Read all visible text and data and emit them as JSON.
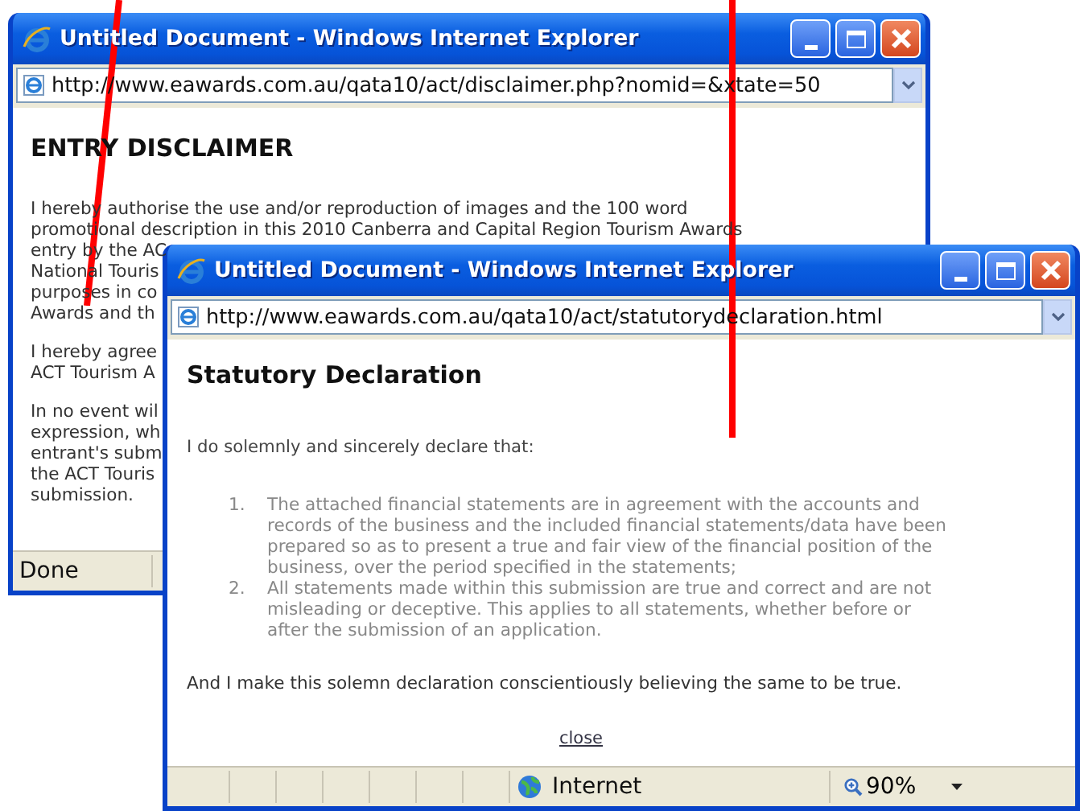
{
  "back_window": {
    "title": "Untitled Document - Windows Internet Explorer",
    "address": "http://www.eawards.com.au/qata10/act/disclaimer.php?nomid=&xtate=50",
    "heading": "ENTRY DISCLAIMER",
    "paragraphs": [
      [
        "I hereby authorise the use and/or reproduction of images and the 100 word",
        "promotional description in this 2010 Canberra and Capital Region Tourism Awards",
        "entry by the AC",
        "National Touris",
        "purposes in co",
        "Awards and th"
      ],
      [
        "I hereby agree",
        "ACT Tourism A"
      ],
      [
        "In no event wil",
        "expression, wh",
        "entrant's subm",
        "the ACT Touris",
        "submission."
      ]
    ],
    "status": "Done"
  },
  "front_window": {
    "title": "Untitled Document - Windows Internet Explorer",
    "address": "http://www.eawards.com.au/qata10/act/statutorydeclaration.html",
    "heading": "Statutory Declaration",
    "intro": "I do solemnly and sincerely declare that:",
    "items": [
      {
        "number": "1.",
        "text": "The attached financial statements are in agreement with the accounts and records of the business and the included financial statements/data have been prepared so as to present a true and fair view of the financial position of the business, over the period specified in the statements;"
      },
      {
        "number": "2.",
        "text": "All statements made within this submission are true and correct and are not misleading or deceptive. This applies to all statements, whether before or after the submission of an application."
      }
    ],
    "closing": "And I make this solemn declaration conscientiously believing the same to be true.",
    "link": "close",
    "zone": "Internet",
    "zoom": "90%"
  }
}
